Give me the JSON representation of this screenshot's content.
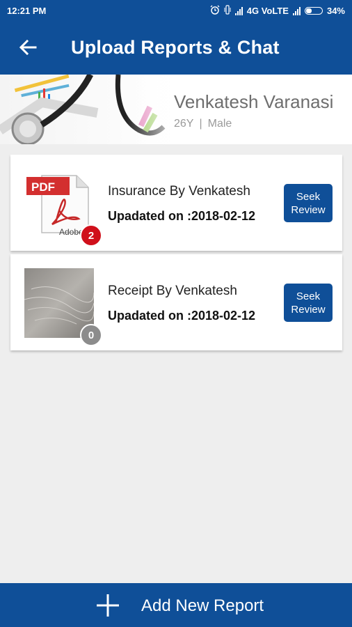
{
  "status_bar": {
    "time": "12:21 PM",
    "network": "4G VoLTE",
    "battery": "34%",
    "icons": [
      "alarm-icon",
      "vibrate-icon",
      "signal-icon",
      "signal-icon",
      "battery-icon"
    ]
  },
  "app_bar": {
    "title": "Upload Reports & Chat",
    "back_icon": "back-arrow-icon"
  },
  "profile": {
    "name": "Venkatesh Varanasi",
    "age": "26Y",
    "separator": "|",
    "gender": "Male"
  },
  "reports": [
    {
      "name": "Insurance By Venkatesh",
      "updated": "Upadated on :2018-02-12",
      "badge_count": "2",
      "badge_color": "#d0101b",
      "thumbnail": "pdf-file-icon",
      "thumb_label": "PDF",
      "thumb_brand": "Adobe",
      "button_line1": "Seek",
      "button_line2": "Review"
    },
    {
      "name": "Receipt By Venkatesh",
      "updated": "Upadated on :2018-02-12",
      "badge_count": "0",
      "badge_color": "#8c8c8c",
      "thumbnail": "photo-thumbnail",
      "button_line1": "Seek",
      "button_line2": "Review"
    }
  ],
  "bottom_action": {
    "label": "Add New Report",
    "icon": "plus-icon"
  },
  "colors": {
    "primary": "#0f4f98",
    "background": "#eeeeee"
  }
}
